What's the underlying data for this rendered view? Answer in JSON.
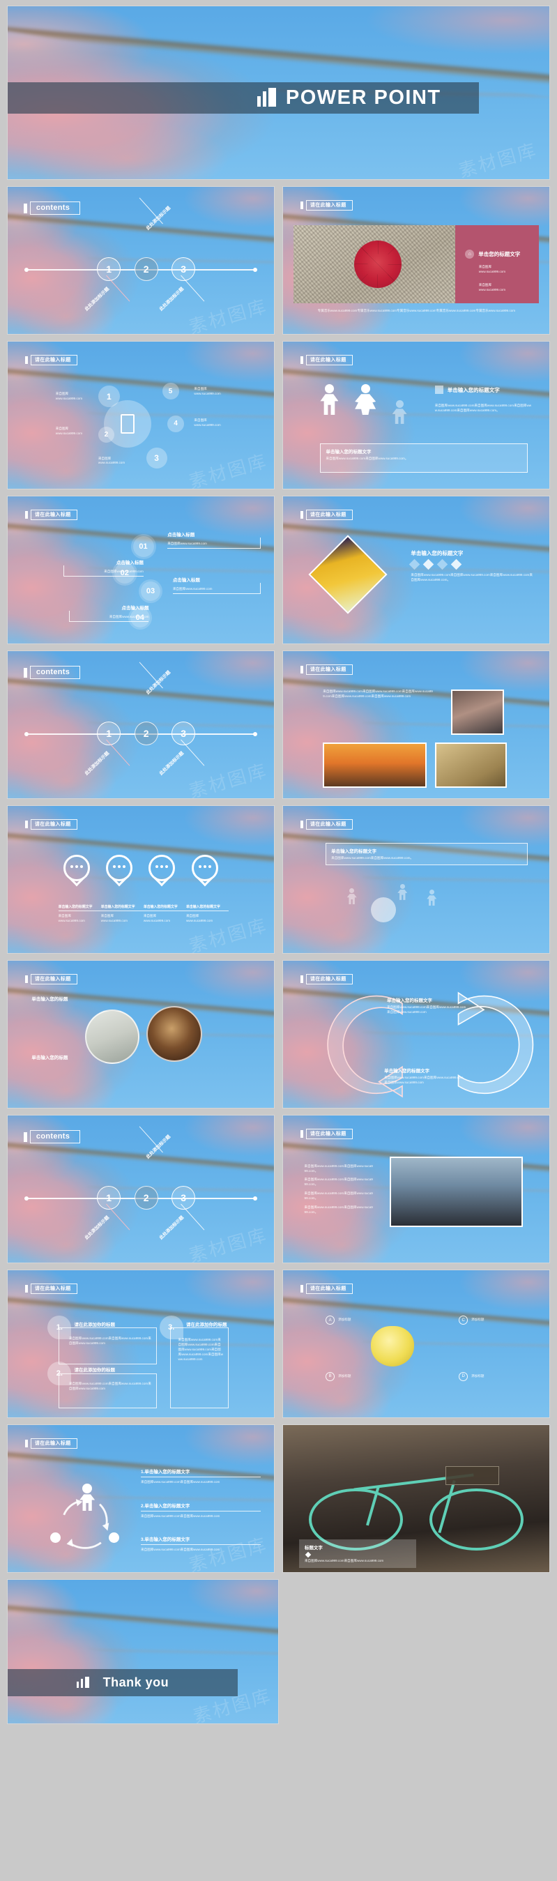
{
  "deck": {
    "title_slide": {
      "title": "POWER POINT",
      "icon": "bar-chart-icon"
    },
    "thanks_slide": {
      "title": "Thank you",
      "icon": "bar-chart-icon"
    },
    "labels": {
      "contents": "contents",
      "header_badge": "请在此输入标题",
      "add_title_here": "此处添加标示题",
      "click_input_title": "点击输入标题",
      "click_your_title_text": "单击输入您的标题文字",
      "single_click_title_text": "单击您的标题文字",
      "add_your_title_here": "请在此添加你的标题",
      "title_text": "标题文字",
      "source": "www.suca999.com",
      "source_label": "来自图库",
      "body_sample": "来自图库www.suca999.com来自图库www.suca999.com来自图库www.suca999.com来自图库www.suca999.com。",
      "body_short": "来自图库www.suca999.com来自图库www.suca999.com。",
      "footer_long": "专属音乐www.suca999.com专属音乐www.suca999.com专属音乐www.suca999.com专属音乐www.suca999.com专属音乐www.suca999.com"
    },
    "timeline": {
      "nodes": [
        "1",
        "2",
        "3"
      ],
      "labels": [
        "此处添加标示题",
        "此处添加标示题",
        "此处添加标示题"
      ]
    },
    "hub_slide": {
      "bubbles": [
        "1",
        "2",
        "3",
        "4",
        "5"
      ],
      "left_items": [
        {
          "title": "来自图库",
          "url": "www.suca999.com"
        },
        {
          "title": "来自图库",
          "url": "www.suca999.com"
        },
        {
          "title": "来自图库",
          "url": "www.suca999.com"
        }
      ],
      "right_items": [
        {
          "title": "来自图库",
          "url": "www.suca999.com"
        },
        {
          "title": "来自图库",
          "url": "www.suca999.com"
        }
      ]
    },
    "gear_slide": {
      "numbers": [
        "01",
        "02",
        "03",
        "04"
      ],
      "headings": [
        "点击输入标题",
        "点击输入标题",
        "点击输入标题",
        "点击输入标题"
      ],
      "bodies": [
        "来自图库www.suca999.com",
        "来自图库www.suca999.com",
        "来自图库www.suca999.com",
        "来自图库www.suca999.com"
      ]
    },
    "pins_slide": {
      "titles": [
        "单击输入您的标题文字",
        "单击输入您的标题文字",
        "单击输入您的标题文字",
        "单击输入您的标题文字"
      ],
      "subs": [
        "来自图库",
        "来自图库",
        "来自图库",
        "来自图库"
      ],
      "urls": [
        "www.suca999.com",
        "www.suca999.com",
        "www.suca999.com",
        "www.suca999.com"
      ]
    },
    "balloons_slide": {
      "heading": "单击输入您的标题文字",
      "body": "来自图库www.suca999.com来自图库www.suca999.com。"
    },
    "arrows_slide": {
      "top_title": "单击输入您的标题文字",
      "top_body": "来自图库www.suca999.com来自图库www.suca999.com来自图库www.suca999.com",
      "bottom_title": "单击输入您的标题文字",
      "bottom_body": "来自图库www.suca999.com来自图库www.suca999.com来自图库www.suca999.com"
    },
    "two_circles_slide": {
      "top_title": "单击输入您的标题",
      "bottom_title": "单击输入您的标题"
    },
    "boxes_slide": {
      "numbers": [
        "1.",
        "2.",
        "3."
      ],
      "titles": [
        "请在此添加你的标题",
        "请在此添加你的标题",
        "请在此添加你的标题"
      ],
      "bodies": [
        "来自图库www.suca999.com来自图库www.suca999.com来自图库www.suca999.com",
        "来自图库www.suca999.com来自图库www.suca999.com来自图库www.suca999.com",
        "来自图库www.suca999.com来自图库www.suca999.com来自图库www.suca999.com来自图库www.suca999.com来自图库www.suca999.com"
      ]
    },
    "lemon_slide": {
      "letters": [
        "A",
        "B",
        "C",
        "D"
      ],
      "titles": [
        "添加标题",
        "添加标题",
        "添加标题",
        "添加标题"
      ]
    },
    "tri_slide": {
      "items": [
        {
          "num": "1.",
          "title": "单击输入您的标题文字",
          "body": "来自图库www.suca999.com来自图库www.suca999.com"
        },
        {
          "num": "2.",
          "title": "单击输入您的标题文字",
          "body": "来自图库www.suca999.com来自图库www.suca999.com"
        },
        {
          "num": "3.",
          "title": "单击输入您的标题文字",
          "body": "来自图库www.suca999.com来自图库www.suca999.com"
        }
      ]
    },
    "bike_slide": {
      "caption_title": "标题文字",
      "caption_body": "来自图库www.suca999.com来自图库www.suca999.com"
    },
    "umbrella_slide": {
      "panel_title": "单击您的标题文字",
      "items": [
        {
          "label": "来自图库",
          "url": "www.suca999.com"
        },
        {
          "label": "来自图库",
          "url": "www.suca999.com"
        }
      ]
    },
    "people_slide": {
      "heading": "单击输入您的标题文字",
      "body": "来自图库www.suca999.com来自图库www.suca999.com来自图库www.suca999.com来自图库www.suca999.com。",
      "box_title": "单击输入您的标题文字",
      "box_body": "来自图库www.suca999.com来自图库www.suca999.com。"
    },
    "diamond_slide": {
      "heading": "单击输入您的标题文字",
      "body": "来自图库www.suca999.com来自图库www.suca999.com来自图库www.suca999.com来自图库www.suca999.com。"
    },
    "photos_slide": {
      "body": "来自图库www.suca999.com来自图库www.suca999.com来自图库www.suca999.com来自图库www.suca999.com来自图库www.suca999.com"
    },
    "watermark": "素材图库"
  }
}
